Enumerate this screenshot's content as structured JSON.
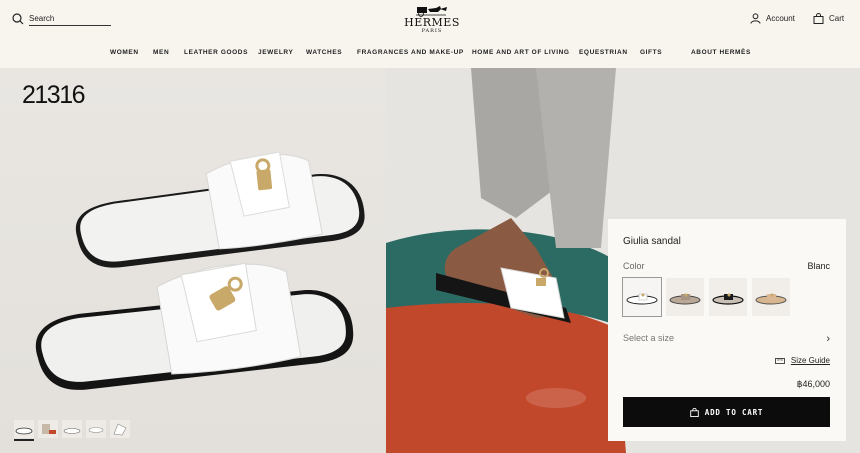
{
  "header": {
    "search_placeholder": "Search",
    "logo_name": "HERMES",
    "logo_sub": "PARIS",
    "account_label": "Account",
    "cart_label": "Cart"
  },
  "nav": [
    {
      "label": "WOMEN"
    },
    {
      "label": "MEN"
    },
    {
      "label": "LEATHER GOODS"
    },
    {
      "label": "JEWELRY"
    },
    {
      "label": "WATCHES"
    },
    {
      "label": "FRAGRANCES AND MAKE-UP"
    },
    {
      "label": "HOME AND ART OF LIVING"
    },
    {
      "label": "EQUESTRIAN"
    },
    {
      "label": "GIFTS"
    },
    {
      "label": "ABOUT HERMÈS"
    }
  ],
  "gallery": {
    "product_code": "21316",
    "thumb_count": 5,
    "active_thumb": 1
  },
  "product": {
    "title": "Giulia sandal",
    "color_label": "Color",
    "color_value": "Blanc",
    "swatches": [
      {
        "name": "Blanc",
        "icon": "white-sandal-swatch"
      },
      {
        "name": "",
        "icon": "beige-sandal-swatch"
      },
      {
        "name": "",
        "icon": "black-sandal-swatch"
      },
      {
        "name": "",
        "icon": "tan-sandal-swatch"
      }
    ],
    "size_placeholder": "Select a size",
    "size_guide_label": "Size Guide",
    "price": "฿46,000",
    "add_to_cart_label": "ADD TO CART"
  },
  "colors": {
    "background": "#f8f5ef",
    "panel": "#fbf9f5",
    "button": "#0c0c0c",
    "platform_teal": "#2c6b63",
    "platform_red": "#c2482c"
  }
}
